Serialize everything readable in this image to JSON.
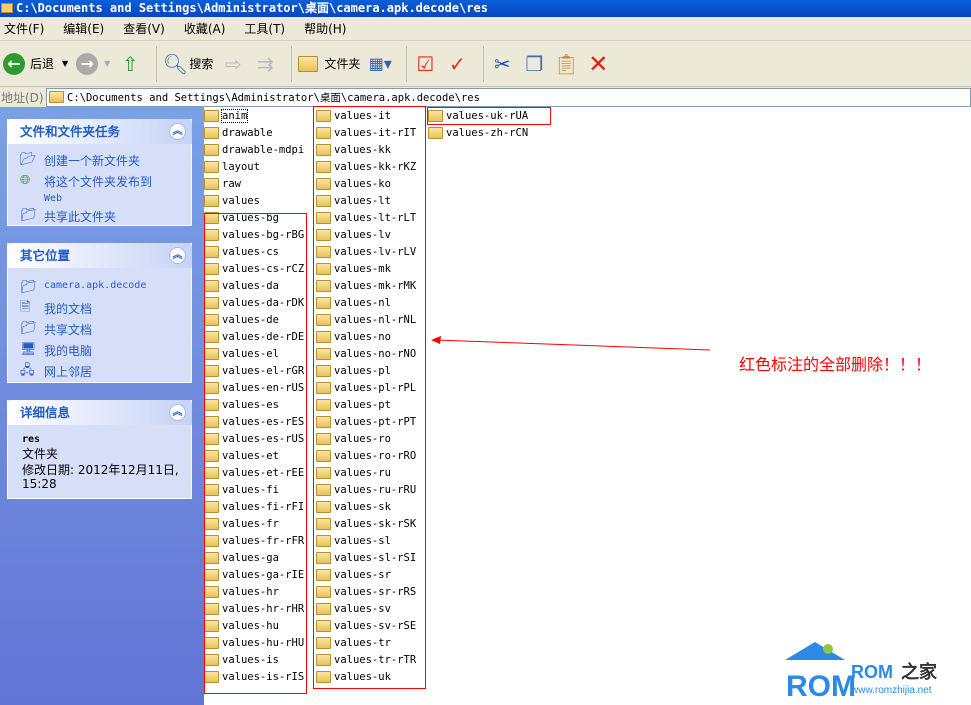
{
  "window": {
    "title": "C:\\Documents and Settings\\Administrator\\桌面\\camera.apk.decode\\res"
  },
  "menu": [
    "文件(F)",
    "编辑(E)",
    "查看(V)",
    "收藏(A)",
    "工具(T)",
    "帮助(H)"
  ],
  "toolbar": {
    "back": "后退",
    "search": "搜索",
    "folders": "文件夹"
  },
  "address": {
    "label": "地址(D)",
    "value": "C:\\Documents and Settings\\Administrator\\桌面\\camera.apk.decode\\res"
  },
  "tasks": {
    "title": "文件和文件夹任务",
    "items": [
      "创建一个新文件夹",
      "将这个文件夹发布到",
      "Web",
      "共享此文件夹"
    ]
  },
  "places": {
    "title": "其它位置",
    "items": [
      "camera.apk.decode",
      "我的文档",
      "共享文档",
      "我的电脑",
      "网上邻居"
    ]
  },
  "details": {
    "title": "详细信息",
    "name": "res",
    "type": "文件夹",
    "modified": "修改日期: 2012年12月11日,",
    "time": "15:28"
  },
  "files": {
    "col1": [
      "anim",
      "drawable",
      "drawable-mdpi",
      "layout",
      "raw",
      "values",
      "values-bg",
      "values-bg-rBG",
      "values-cs",
      "values-cs-rCZ",
      "values-da",
      "values-da-rDK",
      "values-de",
      "values-de-rDE",
      "values-el",
      "values-el-rGR",
      "values-en-rUS",
      "values-es",
      "values-es-rES",
      "values-es-rUS",
      "values-et",
      "values-et-rEE",
      "values-fi",
      "values-fi-rFI",
      "values-fr",
      "values-fr-rFR",
      "values-ga",
      "values-ga-rIE",
      "values-hr",
      "values-hr-rHR",
      "values-hu",
      "values-hu-rHU",
      "values-is",
      "values-is-rIS"
    ],
    "col2": [
      "values-it",
      "values-it-rIT",
      "values-kk",
      "values-kk-rKZ",
      "values-ko",
      "values-lt",
      "values-lt-rLT",
      "values-lv",
      "values-lv-rLV",
      "values-mk",
      "values-mk-rMK",
      "values-nl",
      "values-nl-rNL",
      "values-no",
      "values-no-rNO",
      "values-pl",
      "values-pl-rPL",
      "values-pt",
      "values-pt-rPT",
      "values-ro",
      "values-ro-rRO",
      "values-ru",
      "values-ru-rRU",
      "values-sk",
      "values-sk-rSK",
      "values-sl",
      "values-sl-rSI",
      "values-sr",
      "values-sr-rRS",
      "values-sv",
      "values-sv-rSE",
      "values-tr",
      "values-tr-rTR",
      "values-uk"
    ],
    "col3": [
      "values-uk-rUA",
      "values-zh-rCN"
    ]
  },
  "annotation": {
    "text": "红色标注的全部删除！！！",
    "color": "#ff0000"
  },
  "watermark": {
    "brand": "ROM之家",
    "url": "www.romzhijia.net"
  }
}
